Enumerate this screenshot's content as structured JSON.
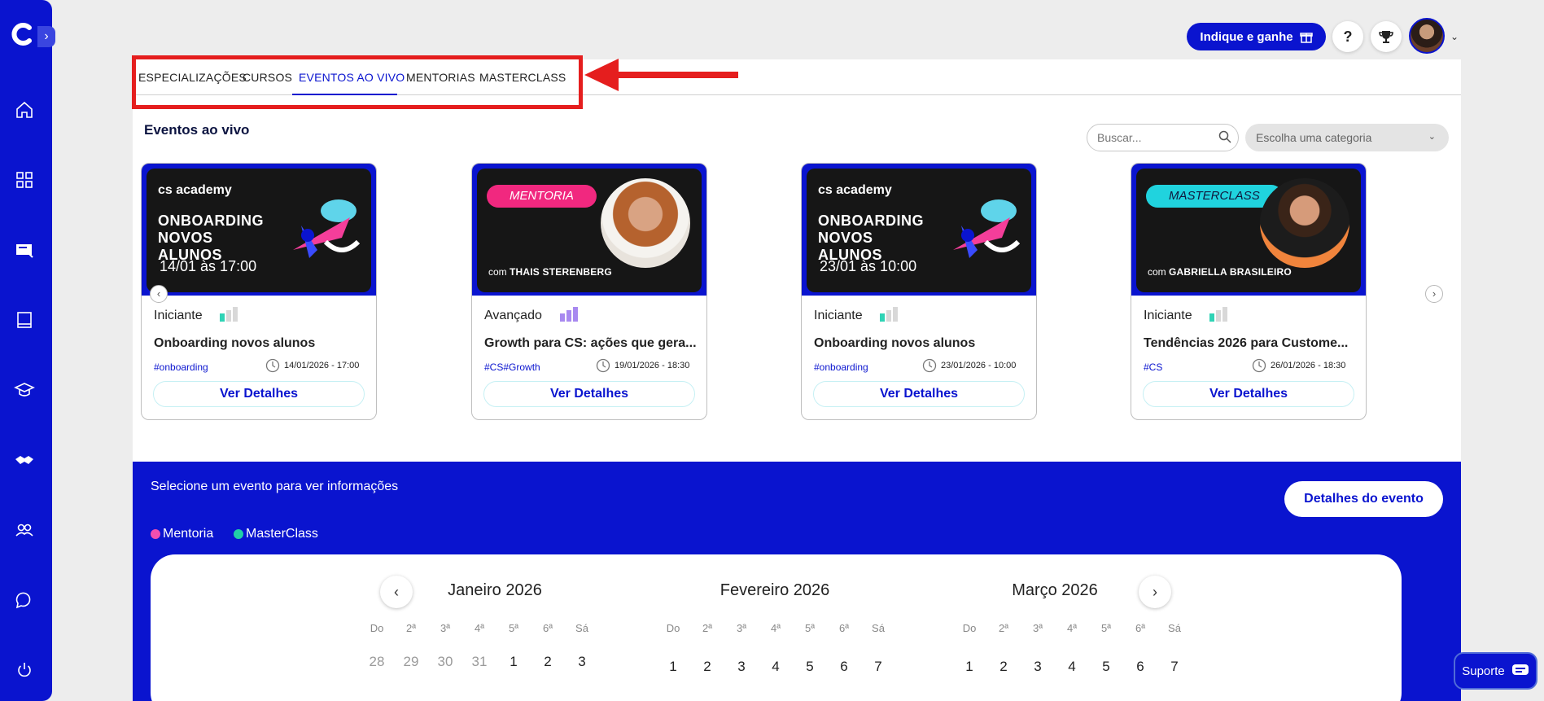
{
  "header": {
    "refer_label": "Indique e ganhe",
    "help_label": "?"
  },
  "tabs": [
    {
      "label": "ESPECIALIZAÇÕES"
    },
    {
      "label": "CURSOS"
    },
    {
      "label": "EVENTOS AO VIVO",
      "active": true
    },
    {
      "label": "MENTORIAS"
    },
    {
      "label": "MASTERCLASS"
    }
  ],
  "section": {
    "title": "Eventos ao vivo",
    "search_placeholder": "Buscar...",
    "category_placeholder": "Escolha uma categoria"
  },
  "cards": [
    {
      "banner_brand": "cs academy",
      "banner_title": "ONBOARDING NOVOS ALUNOS",
      "banner_when": "14/01 às 17:00",
      "level": "Iniciante",
      "level_value": 1,
      "title": "Onboarding novos alunos",
      "tag": "#onboarding",
      "date": "14/01/2026 - 17:00",
      "button": "Ver Detalhes"
    },
    {
      "banner_pill": "MENTORIA",
      "banner_host_prefix": "com",
      "banner_host": "THAIS STERENBERG",
      "level": "Avançado",
      "level_value": 3,
      "title": "Growth para CS: ações que gera...",
      "tag": "#CS#Growth",
      "date": "19/01/2026 - 18:30",
      "button": "Ver Detalhes"
    },
    {
      "banner_brand": "cs academy",
      "banner_title": "ONBOARDING NOVOS ALUNOS",
      "banner_when": "23/01 às 10:00",
      "level": "Iniciante",
      "level_value": 1,
      "title": "Onboarding novos alunos",
      "tag": "#onboarding",
      "date": "23/01/2026 - 10:00",
      "button": "Ver Detalhes"
    },
    {
      "banner_pill": "MASTERCLASS",
      "banner_host_prefix": "com",
      "banner_host": "GABRIELLA BRASILEIRO",
      "level": "Iniciante",
      "level_value": 1,
      "title": "Tendências 2026 para Custome...",
      "tag": "#CS",
      "date": "26/01/2026 - 18:30",
      "button": "Ver Detalhes"
    }
  ],
  "calendar": {
    "hint": "Selecione um evento para ver informações",
    "details_button": "Detalhes do evento",
    "legend": [
      {
        "label": "Mentoria",
        "color": "#f14fb0"
      },
      {
        "label": "MasterClass",
        "color": "#21cfa8"
      }
    ],
    "weekdays": [
      "Do",
      "2ª",
      "3ª",
      "4ª",
      "5ª",
      "6ª",
      "Sá"
    ],
    "months": [
      {
        "name": "Janeiro 2026",
        "first_row": [
          "28",
          "29",
          "30",
          "31",
          "1",
          "2",
          "3"
        ],
        "muted_count": 4
      },
      {
        "name": "Fevereiro 2026",
        "first_row": [
          "1",
          "2",
          "3",
          "4",
          "5",
          "6",
          "7"
        ],
        "muted_count": 0
      },
      {
        "name": "Março 2026",
        "first_row": [
          "1",
          "2",
          "3",
          "4",
          "5",
          "6",
          "7"
        ],
        "muted_count": 0
      }
    ]
  },
  "support_label": "Suporte",
  "colors": {
    "brand_blue": "#0a14cf",
    "annotation_red": "#e51e1e",
    "mentoria_pink": "#f1287f",
    "masterclass_cyan": "#20d3de"
  }
}
